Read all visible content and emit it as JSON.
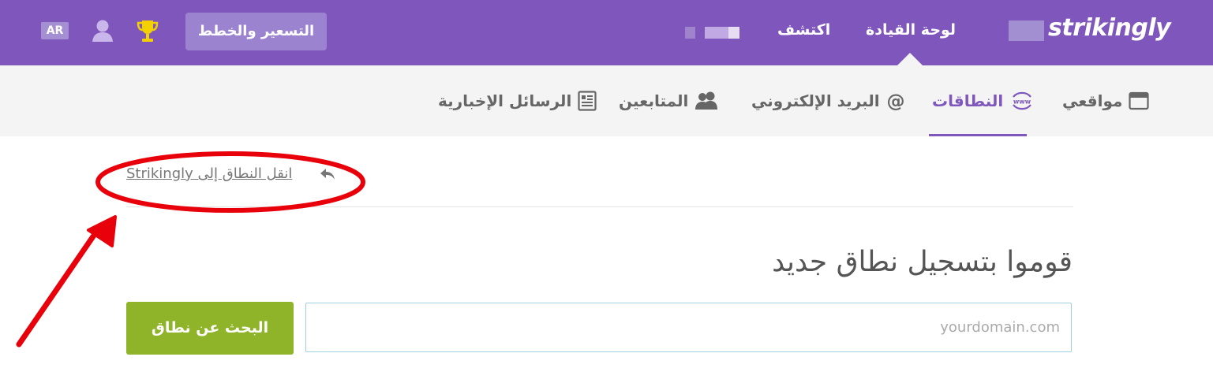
{
  "topbar": {
    "lang_label": "AR",
    "pricing_label": "التسعير والخطط",
    "nav_discover": "اكتشف",
    "nav_dashboard": "لوحة القيادة",
    "logo_text": "strikingly",
    "background": "#7f57bc"
  },
  "tabs": [
    {
      "label": "مواقعي",
      "icon": "browser-window-icon",
      "active": false
    },
    {
      "label": "النطاقات",
      "icon": "www-icon",
      "active": true
    },
    {
      "label": "البريد الإلكتروني",
      "icon": "at-sign-icon",
      "active": false
    },
    {
      "label": "المتابعين",
      "icon": "users-icon",
      "active": false
    },
    {
      "label": "الرسائل الإخبارية",
      "icon": "newsletter-icon",
      "active": false
    }
  ],
  "content": {
    "transfer_link": "انقل النطاق إلى Strikingly",
    "heading": "قوموا بتسجيل نطاق جديد",
    "search_button": "البحث عن نطاق",
    "domain_input_placeholder": "yourdomain.com",
    "domain_input_value": ""
  },
  "colors": {
    "accent": "#7f57bc",
    "button_green": "#8fb42a",
    "annotation_red": "#e8000b"
  }
}
